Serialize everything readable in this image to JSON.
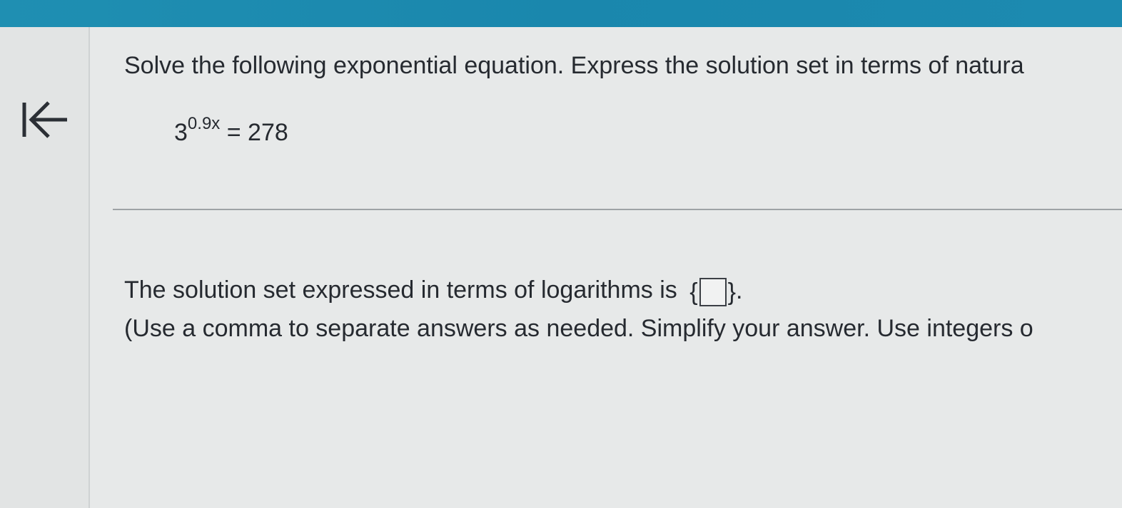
{
  "instruction": "Solve the following exponential equation. Express the solution set in terms of natura",
  "equation": {
    "base": "3",
    "exponent": "0.9x",
    "rhs": "= 278"
  },
  "answer": {
    "prefix": "The solution set expressed in terms of logarithms is",
    "open_brace": "{",
    "close_brace": "}",
    "suffix": ".",
    "value": ""
  },
  "hint": "(Use a comma to separate answers as needed. Simplify your answer. Use integers o",
  "icons": {
    "collapse": "collapse-left-arrow-icon"
  },
  "colors": {
    "top_bar": "#1f8fb2",
    "background": "#e7e9e9",
    "text": "#262a30"
  }
}
